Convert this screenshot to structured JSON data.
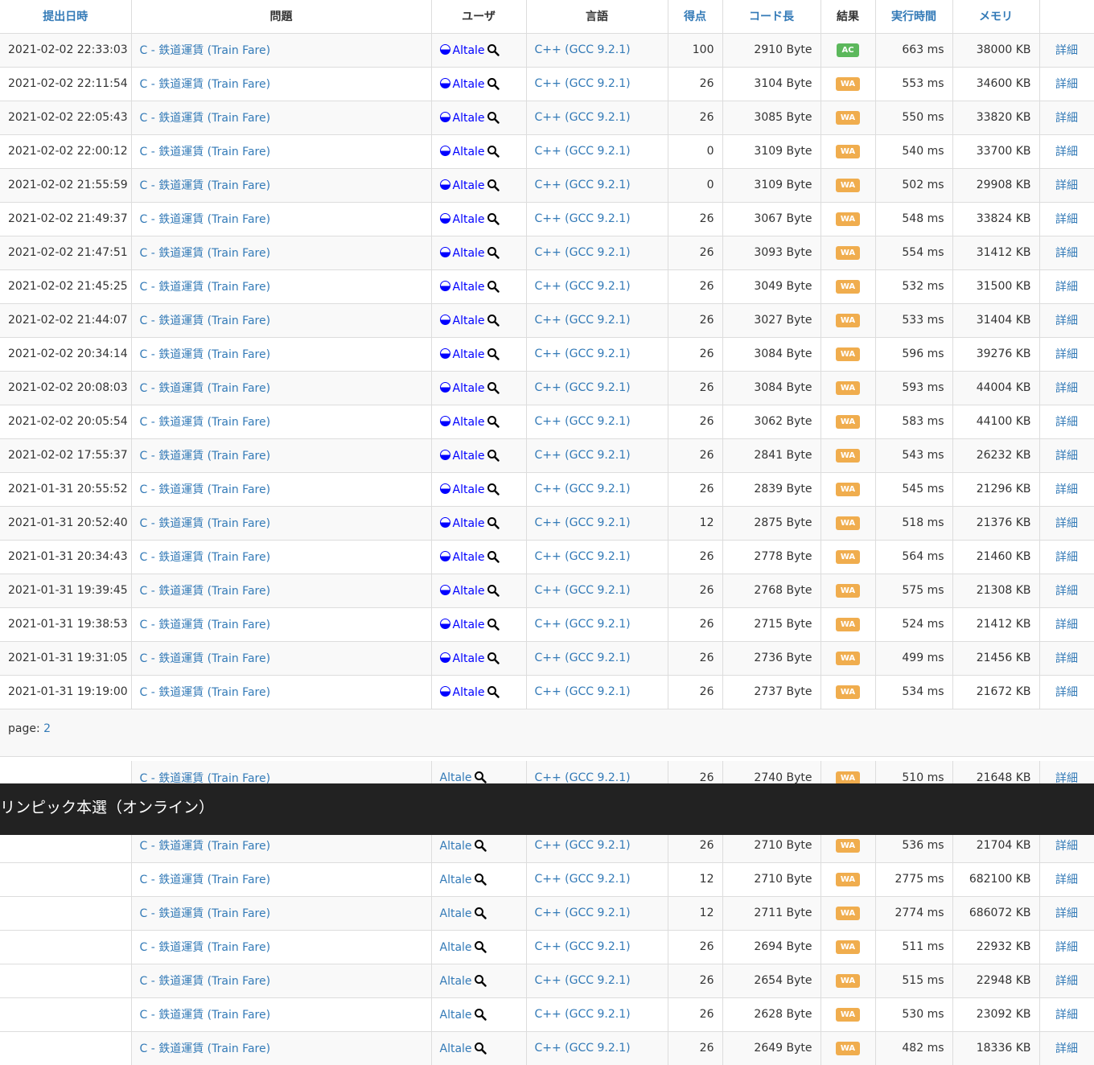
{
  "headers": [
    "提出日時",
    "問題",
    "ユーザ",
    "言語",
    "得点",
    "コード長",
    "結果",
    "実行時間",
    "メモリ",
    ""
  ],
  "rows": [
    {
      "date": "2021-02-02 22:33:03",
      "task": "C - 鉄道運賃 (Train Fare)",
      "user": "Altale",
      "lang": "C++ (GCC 9.2.1)",
      "score": "100",
      "size": "2910 Byte",
      "result": "AC",
      "time": "663 ms",
      "mem": "38000 KB",
      "detail": "詳細"
    },
    {
      "date": "2021-02-02 22:11:54",
      "task": "C - 鉄道運賃 (Train Fare)",
      "user": "Altale",
      "lang": "C++ (GCC 9.2.1)",
      "score": "26",
      "size": "3104 Byte",
      "result": "WA",
      "time": "553 ms",
      "mem": "34600 KB",
      "detail": "詳細"
    },
    {
      "date": "2021-02-02 22:05:43",
      "task": "C - 鉄道運賃 (Train Fare)",
      "user": "Altale",
      "lang": "C++ (GCC 9.2.1)",
      "score": "26",
      "size": "3085 Byte",
      "result": "WA",
      "time": "550 ms",
      "mem": "33820 KB",
      "detail": "詳細"
    },
    {
      "date": "2021-02-02 22:00:12",
      "task": "C - 鉄道運賃 (Train Fare)",
      "user": "Altale",
      "lang": "C++ (GCC 9.2.1)",
      "score": "0",
      "size": "3109 Byte",
      "result": "WA",
      "time": "540 ms",
      "mem": "33700 KB",
      "detail": "詳細"
    },
    {
      "date": "2021-02-02 21:55:59",
      "task": "C - 鉄道運賃 (Train Fare)",
      "user": "Altale",
      "lang": "C++ (GCC 9.2.1)",
      "score": "0",
      "size": "3109 Byte",
      "result": "WA",
      "time": "502 ms",
      "mem": "29908 KB",
      "detail": "詳細"
    },
    {
      "date": "2021-02-02 21:49:37",
      "task": "C - 鉄道運賃 (Train Fare)",
      "user": "Altale",
      "lang": "C++ (GCC 9.2.1)",
      "score": "26",
      "size": "3067 Byte",
      "result": "WA",
      "time": "548 ms",
      "mem": "33824 KB",
      "detail": "詳細"
    },
    {
      "date": "2021-02-02 21:47:51",
      "task": "C - 鉄道運賃 (Train Fare)",
      "user": "Altale",
      "lang": "C++ (GCC 9.2.1)",
      "score": "26",
      "size": "3093 Byte",
      "result": "WA",
      "time": "554 ms",
      "mem": "31412 KB",
      "detail": "詳細"
    },
    {
      "date": "2021-02-02 21:45:25",
      "task": "C - 鉄道運賃 (Train Fare)",
      "user": "Altale",
      "lang": "C++ (GCC 9.2.1)",
      "score": "26",
      "size": "3049 Byte",
      "result": "WA",
      "time": "532 ms",
      "mem": "31500 KB",
      "detail": "詳細"
    },
    {
      "date": "2021-02-02 21:44:07",
      "task": "C - 鉄道運賃 (Train Fare)",
      "user": "Altale",
      "lang": "C++ (GCC 9.2.1)",
      "score": "26",
      "size": "3027 Byte",
      "result": "WA",
      "time": "533 ms",
      "mem": "31404 KB",
      "detail": "詳細"
    },
    {
      "date": "2021-02-02 20:34:14",
      "task": "C - 鉄道運賃 (Train Fare)",
      "user": "Altale",
      "lang": "C++ (GCC 9.2.1)",
      "score": "26",
      "size": "3084 Byte",
      "result": "WA",
      "time": "596 ms",
      "mem": "39276 KB",
      "detail": "詳細"
    },
    {
      "date": "2021-02-02 20:08:03",
      "task": "C - 鉄道運賃 (Train Fare)",
      "user": "Altale",
      "lang": "C++ (GCC 9.2.1)",
      "score": "26",
      "size": "3084 Byte",
      "result": "WA",
      "time": "593 ms",
      "mem": "44004 KB",
      "detail": "詳細"
    },
    {
      "date": "2021-02-02 20:05:54",
      "task": "C - 鉄道運賃 (Train Fare)",
      "user": "Altale",
      "lang": "C++ (GCC 9.2.1)",
      "score": "26",
      "size": "3062 Byte",
      "result": "WA",
      "time": "583 ms",
      "mem": "44100 KB",
      "detail": "詳細"
    },
    {
      "date": "2021-02-02 17:55:37",
      "task": "C - 鉄道運賃 (Train Fare)",
      "user": "Altale",
      "lang": "C++ (GCC 9.2.1)",
      "score": "26",
      "size": "2841 Byte",
      "result": "WA",
      "time": "543 ms",
      "mem": "26232 KB",
      "detail": "詳細"
    },
    {
      "date": "2021-01-31 20:55:52",
      "task": "C - 鉄道運賃 (Train Fare)",
      "user": "Altale",
      "lang": "C++ (GCC 9.2.1)",
      "score": "26",
      "size": "2839 Byte",
      "result": "WA",
      "time": "545 ms",
      "mem": "21296 KB",
      "detail": "詳細"
    },
    {
      "date": "2021-01-31 20:52:40",
      "task": "C - 鉄道運賃 (Train Fare)",
      "user": "Altale",
      "lang": "C++ (GCC 9.2.1)",
      "score": "12",
      "size": "2875 Byte",
      "result": "WA",
      "time": "518 ms",
      "mem": "21376 KB",
      "detail": "詳細"
    },
    {
      "date": "2021-01-31 20:34:43",
      "task": "C - 鉄道運賃 (Train Fare)",
      "user": "Altale",
      "lang": "C++ (GCC 9.2.1)",
      "score": "26",
      "size": "2778 Byte",
      "result": "WA",
      "time": "564 ms",
      "mem": "21460 KB",
      "detail": "詳細"
    },
    {
      "date": "2021-01-31 19:39:45",
      "task": "C - 鉄道運賃 (Train Fare)",
      "user": "Altale",
      "lang": "C++ (GCC 9.2.1)",
      "score": "26",
      "size": "2768 Byte",
      "result": "WA",
      "time": "575 ms",
      "mem": "21308 KB",
      "detail": "詳細"
    },
    {
      "date": "2021-01-31 19:38:53",
      "task": "C - 鉄道運賃 (Train Fare)",
      "user": "Altale",
      "lang": "C++ (GCC 9.2.1)",
      "score": "26",
      "size": "2715 Byte",
      "result": "WA",
      "time": "524 ms",
      "mem": "21412 KB",
      "detail": "詳細"
    },
    {
      "date": "2021-01-31 19:31:05",
      "task": "C - 鉄道運賃 (Train Fare)",
      "user": "Altale",
      "lang": "C++ (GCC 9.2.1)",
      "score": "26",
      "size": "2736 Byte",
      "result": "WA",
      "time": "499 ms",
      "mem": "21456 KB",
      "detail": "詳細"
    },
    {
      "date": "2021-01-31 19:19:00",
      "task": "C - 鉄道運賃 (Train Fare)",
      "user": "Altale",
      "lang": "C++ (GCC 9.2.1)",
      "score": "26",
      "size": "2737 Byte",
      "result": "WA",
      "time": "534 ms",
      "mem": "21672 KB",
      "detail": "詳細"
    }
  ],
  "pager": {
    "label": "page:",
    "page": "2"
  },
  "overlay_title": "リンピック本選（オンライン）",
  "rows2": [
    {
      "task": "C - 鉄道運賃 (Train Fare)",
      "user": "Altale",
      "lang": "C++ (GCC 9.2.1)",
      "score": "26",
      "size": "2740 Byte",
      "result": "WA",
      "time": "510 ms",
      "mem": "21648 KB",
      "detail": "詳細"
    },
    {
      "task": "",
      "user": "",
      "lang": "",
      "score": "",
      "size": "",
      "result": "",
      "time": "",
      "mem": "",
      "detail": ""
    },
    {
      "task": "C - 鉄道運賃 (Train Fare)",
      "user": "Altale",
      "lang": "C++ (GCC 9.2.1)",
      "score": "26",
      "size": "2710 Byte",
      "result": "WA",
      "time": "536 ms",
      "mem": "21704 KB",
      "detail": "詳細"
    },
    {
      "task": "C - 鉄道運賃 (Train Fare)",
      "user": "Altale",
      "lang": "C++ (GCC 9.2.1)",
      "score": "12",
      "size": "2710 Byte",
      "result": "WA",
      "time": "2775 ms",
      "mem": "682100 KB",
      "detail": "詳細"
    },
    {
      "task": "C - 鉄道運賃 (Train Fare)",
      "user": "Altale",
      "lang": "C++ (GCC 9.2.1)",
      "score": "12",
      "size": "2711 Byte",
      "result": "WA",
      "time": "2774 ms",
      "mem": "686072 KB",
      "detail": "詳細"
    },
    {
      "task": "C - 鉄道運賃 (Train Fare)",
      "user": "Altale",
      "lang": "C++ (GCC 9.2.1)",
      "score": "26",
      "size": "2694 Byte",
      "result": "WA",
      "time": "511 ms",
      "mem": "22932 KB",
      "detail": "詳細"
    },
    {
      "task": "C - 鉄道運賃 (Train Fare)",
      "user": "Altale",
      "lang": "C++ (GCC 9.2.1)",
      "score": "26",
      "size": "2654 Byte",
      "result": "WA",
      "time": "515 ms",
      "mem": "22948 KB",
      "detail": "詳細"
    },
    {
      "task": "C - 鉄道運賃 (Train Fare)",
      "user": "Altale",
      "lang": "C++ (GCC 9.2.1)",
      "score": "26",
      "size": "2628 Byte",
      "result": "WA",
      "time": "530 ms",
      "mem": "23092 KB",
      "detail": "詳細"
    },
    {
      "task": "C - 鉄道運賃 (Train Fare)",
      "user": "Altale",
      "lang": "C++ (GCC 9.2.1)",
      "score": "26",
      "size": "2649 Byte",
      "result": "WA",
      "time": "482 ms",
      "mem": "18336 KB",
      "detail": "詳細"
    }
  ],
  "colors": {
    "link": "#337ab7",
    "user": "#0000ff",
    "ac": "#5cb85c",
    "wa": "#f0ad4e",
    "overlay": "#222222"
  },
  "icons": {
    "rank": "rank-circle-icon",
    "search": "magnifier-icon"
  }
}
